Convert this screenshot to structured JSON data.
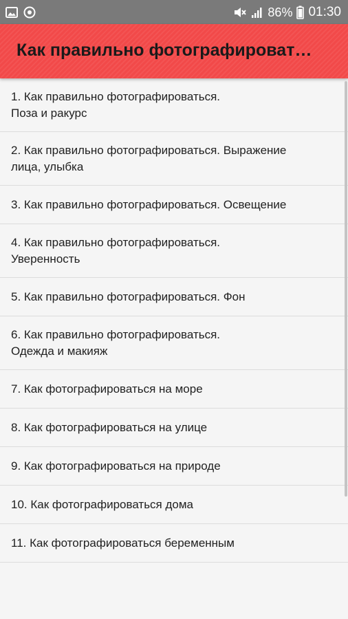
{
  "status_bar": {
    "left_icons": [
      "image-icon",
      "target-icon"
    ],
    "battery_percent": "86%",
    "time": "01:30",
    "right_icons": [
      "mute-icon",
      "signal-icon",
      "battery-icon"
    ]
  },
  "app_bar": {
    "title": "Как правильно фотографироваться"
  },
  "list": {
    "items": [
      {
        "text": "1. Как правильно фотографироваться.\nПоза и ракурс"
      },
      {
        "text": "2. Как правильно фотографироваться. Выражение лица, улыбка"
      },
      {
        "text": "3. Как правильно фотографироваться. Освещение"
      },
      {
        "text": "4. Как правильно фотографироваться.\nУверенность"
      },
      {
        "text": "5. Как правильно фотографироваться. Фон"
      },
      {
        "text": "6. Как правильно фотографироваться.\nОдежда и макияж"
      },
      {
        "text": "7. Как фотографироваться на море"
      },
      {
        "text": "8. Как фотографироваться на улице"
      },
      {
        "text": "9. Как фотографироваться на природе"
      },
      {
        "text": "10. Как фотографироваться дома"
      },
      {
        "text": "11. Как фотографироваться беременным"
      }
    ]
  },
  "colors": {
    "app_bar": "#f24949",
    "status_bar": "#7a7a7a",
    "background": "#f5f5f5"
  }
}
